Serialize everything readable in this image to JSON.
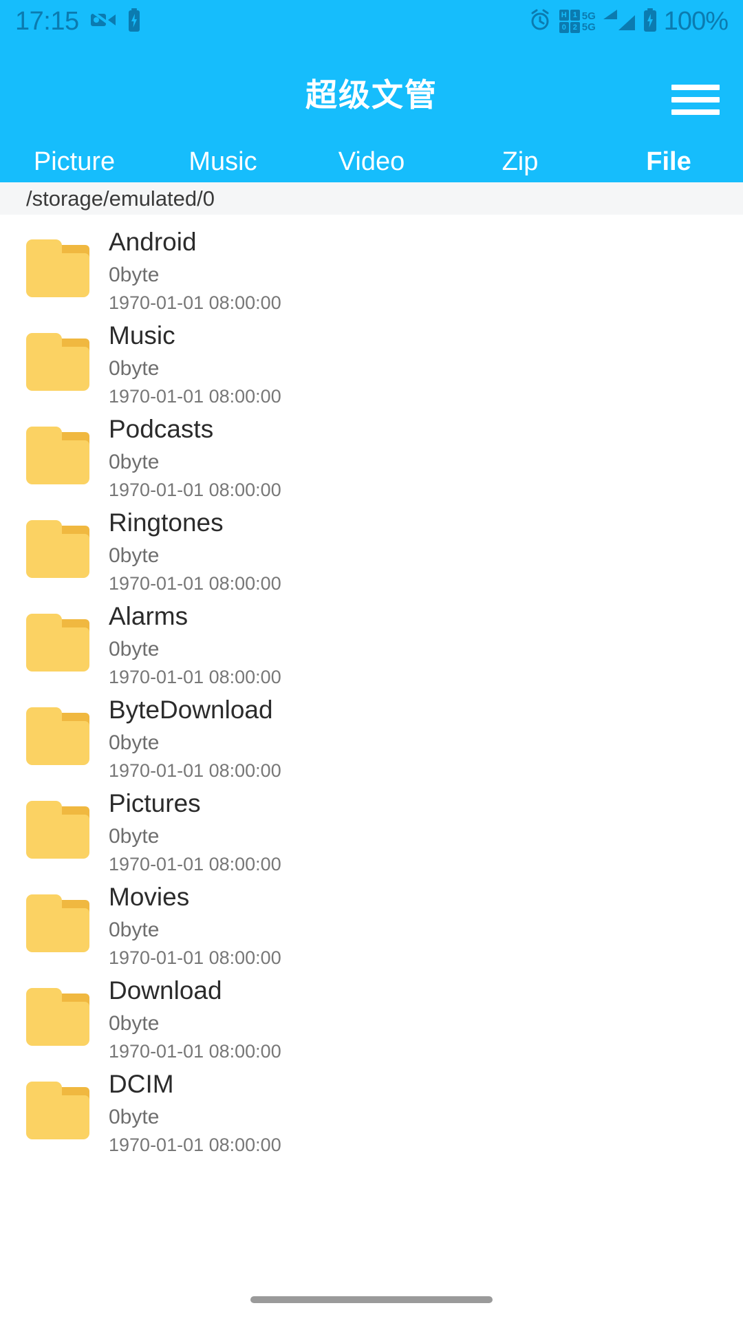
{
  "status_bar": {
    "time": "17:15",
    "battery_percent": "100%",
    "icons": {
      "video_off": "video-off-icon",
      "charging": "battery-charging-icon",
      "alarm": "alarm-icon",
      "signal": "signal-bars-icon",
      "battery": "battery-icon"
    },
    "sim": {
      "row1_left": "H",
      "row1_right": "1",
      "row2_left": "0",
      "row2_right": "2",
      "net1": "5G",
      "net2": "5G"
    }
  },
  "app_bar": {
    "title": "超级文管",
    "menu_icon": "hamburger-menu-icon"
  },
  "tabs": [
    {
      "label": "Picture",
      "active": false
    },
    {
      "label": "Music",
      "active": false
    },
    {
      "label": "Video",
      "active": false
    },
    {
      "label": "Zip",
      "active": false
    },
    {
      "label": "File",
      "active": true
    }
  ],
  "path_bar": {
    "path": "/storage/emulated/0"
  },
  "files": [
    {
      "name": "Android",
      "size": "0byte",
      "date": "1970-01-01 08:00:00",
      "type": "folder"
    },
    {
      "name": "Music",
      "size": "0byte",
      "date": "1970-01-01 08:00:00",
      "type": "folder"
    },
    {
      "name": "Podcasts",
      "size": "0byte",
      "date": "1970-01-01 08:00:00",
      "type": "folder"
    },
    {
      "name": "Ringtones",
      "size": "0byte",
      "date": "1970-01-01 08:00:00",
      "type": "folder"
    },
    {
      "name": "Alarms",
      "size": "0byte",
      "date": "1970-01-01 08:00:00",
      "type": "folder"
    },
    {
      "name": "ByteDownload",
      "size": "0byte",
      "date": "1970-01-01 08:00:00",
      "type": "folder"
    },
    {
      "name": "Pictures",
      "size": "0byte",
      "date": "1970-01-01 08:00:00",
      "type": "folder"
    },
    {
      "name": "Movies",
      "size": "0byte",
      "date": "1970-01-01 08:00:00",
      "type": "folder"
    },
    {
      "name": "Download",
      "size": "0byte",
      "date": "1970-01-01 08:00:00",
      "type": "folder"
    },
    {
      "name": "DCIM",
      "size": "0byte",
      "date": "1970-01-01 08:00:00",
      "type": "folder"
    }
  ],
  "colors": {
    "accent": "#16BDFC",
    "status_icon": "#0b7bb0",
    "folder_body": "#FBD263",
    "folder_tab": "#F0B840",
    "path_bg": "#f5f6f7",
    "title_text": "#ffffff",
    "name_text": "#2b2b2b",
    "meta_text": "#6e6e6e"
  }
}
